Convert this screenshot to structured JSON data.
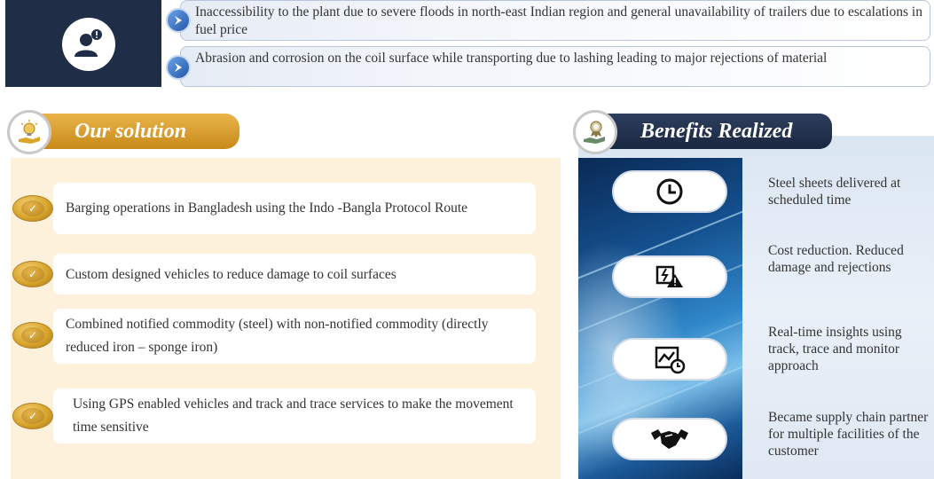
{
  "challenges": {
    "items": [
      {
        "text": "Inaccessibility to the plant due to severe floods in north-east Indian region and general unavailability of trailers due to escalations in fuel price",
        "icon": "chevron-right-icon"
      },
      {
        "text": "Abrasion and corrosion on the coil surface while transporting due to lashing leading to major rejections of material",
        "icon": "chevron-right-icon"
      }
    ],
    "icon": "person-alert-icon"
  },
  "solution": {
    "title": "Our solution",
    "icon": "lightbulb-hand-icon",
    "items": [
      "Barging operations in Bangladesh using the Indo -Bangla Protocol Route",
      "Custom designed vehicles to reduce damage to coil surfaces",
      "Combined notified commodity (steel) with non-notified commodity (directly reduced iron – sponge iron)",
      "Using GPS enabled vehicles and track and trace services to make the movement time sensitive"
    ]
  },
  "benefits": {
    "title": "Benefits Realized",
    "icon": "medal-hand-icon",
    "items": [
      {
        "text": "Steel sheets delivered at scheduled time",
        "icon": "clock-icon"
      },
      {
        "text": "Cost reduction. Reduced damage and rejections",
        "icon": "damage-alert-icon"
      },
      {
        "text": "Real-time insights using track, trace and monitor approach",
        "icon": "analytics-clock-icon"
      },
      {
        "text": "Became supply chain partner for multiple facilities of the customer",
        "icon": "handshake-icon"
      }
    ]
  },
  "colors": {
    "navy": "#1f2d47",
    "gold": "#d9a52b",
    "cream": "#fdf1dc",
    "blue": "#2457a8"
  }
}
